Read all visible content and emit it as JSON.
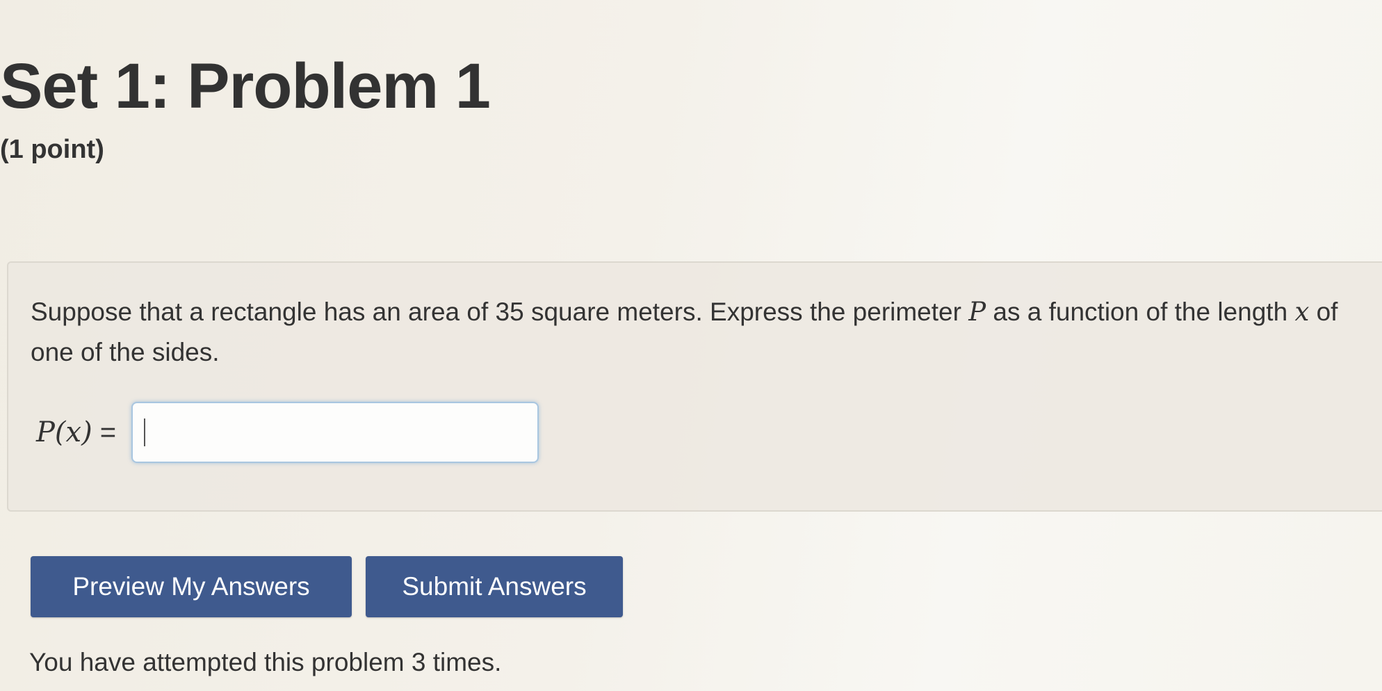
{
  "header": {
    "title": "Set 1: Problem 1",
    "points": "(1 point)"
  },
  "problem": {
    "text_part1": "Suppose that a rectangle has an area of 35 square meters. Express the perimeter ",
    "var_P": "P",
    "text_part2": " as a function of the length ",
    "var_x": "x",
    "text_part3": " of one of the sides.",
    "answer_label": "P(x)",
    "answer_equals": " =",
    "answer_value": ""
  },
  "actions": {
    "preview_label": "Preview My Answers",
    "submit_label": "Submit Answers"
  },
  "status": {
    "attempts_text": "You have attempted this problem 3 times."
  },
  "colors": {
    "button_bg": "#3f5a8e",
    "input_focus_border": "#a9c6e0"
  }
}
